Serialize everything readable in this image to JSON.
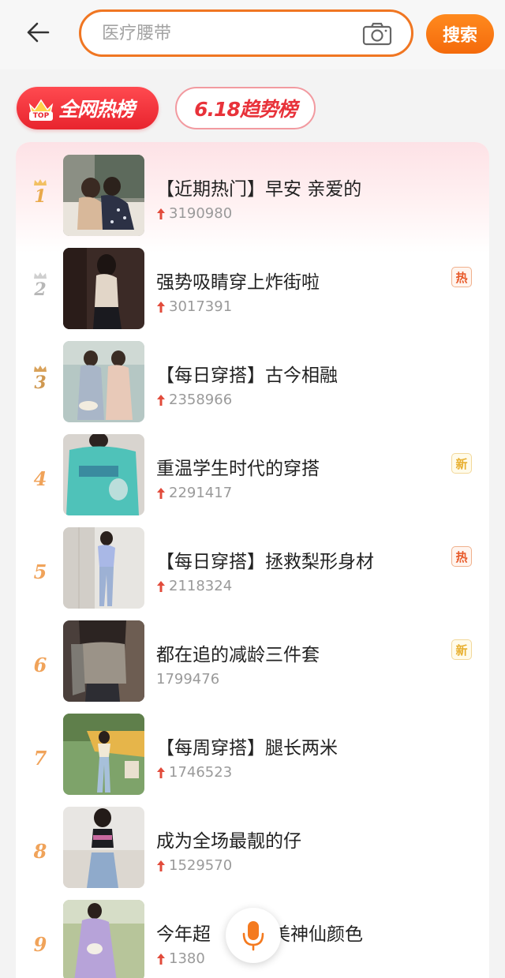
{
  "header": {
    "back_icon": "arrow-left-icon",
    "search_placeholder": "医疗腰带",
    "camera_icon": "camera-icon",
    "search_button_label": "搜索"
  },
  "tabs": [
    {
      "label": "全网热榜",
      "badge": "TOP",
      "active": true
    },
    {
      "label": "6.18趋势榜",
      "active": false
    }
  ],
  "colors": {
    "accent": "#f07622",
    "hot_red": "#e8242e",
    "rank_gold": "#e9a94a",
    "rank_silver": "#b7b7b7",
    "rank_bronze": "#cf9850",
    "rank_plain": "#f0a35a",
    "tag_hot": "#e85a2a",
    "tag_new": "#e8b030"
  },
  "ranking": [
    {
      "rank": "1",
      "title": "【近期热门】早安 亲爱的",
      "count": "3190980",
      "trend_up": true,
      "tag": ""
    },
    {
      "rank": "2",
      "title": "强势吸睛穿上炸街啦",
      "count": "3017391",
      "trend_up": true,
      "tag": "热"
    },
    {
      "rank": "3",
      "title": "【每日穿搭】古今相融",
      "count": "2358966",
      "trend_up": true,
      "tag": ""
    },
    {
      "rank": "4",
      "title": "重温学生时代的穿搭",
      "count": "2291417",
      "trend_up": true,
      "tag": "新"
    },
    {
      "rank": "5",
      "title": "【每日穿搭】拯救梨形身材",
      "count": "2118324",
      "trend_up": true,
      "tag": "热"
    },
    {
      "rank": "6",
      "title": "都在追的减龄三件套",
      "count": "1799476",
      "trend_up": false,
      "tag": "新"
    },
    {
      "rank": "7",
      "title": "【每周穿搭】腿长两米",
      "count": "1746523",
      "trend_up": true,
      "tag": ""
    },
    {
      "rank": "8",
      "title": "成为全场最靓的仔",
      "count": "1529570",
      "trend_up": true,
      "tag": ""
    },
    {
      "rank": "9",
      "title": "今年超",
      "title_tail": "美神仙颜色",
      "count": "1380",
      "trend_up": true,
      "tag": ""
    }
  ],
  "mic_icon": "microphone-icon"
}
